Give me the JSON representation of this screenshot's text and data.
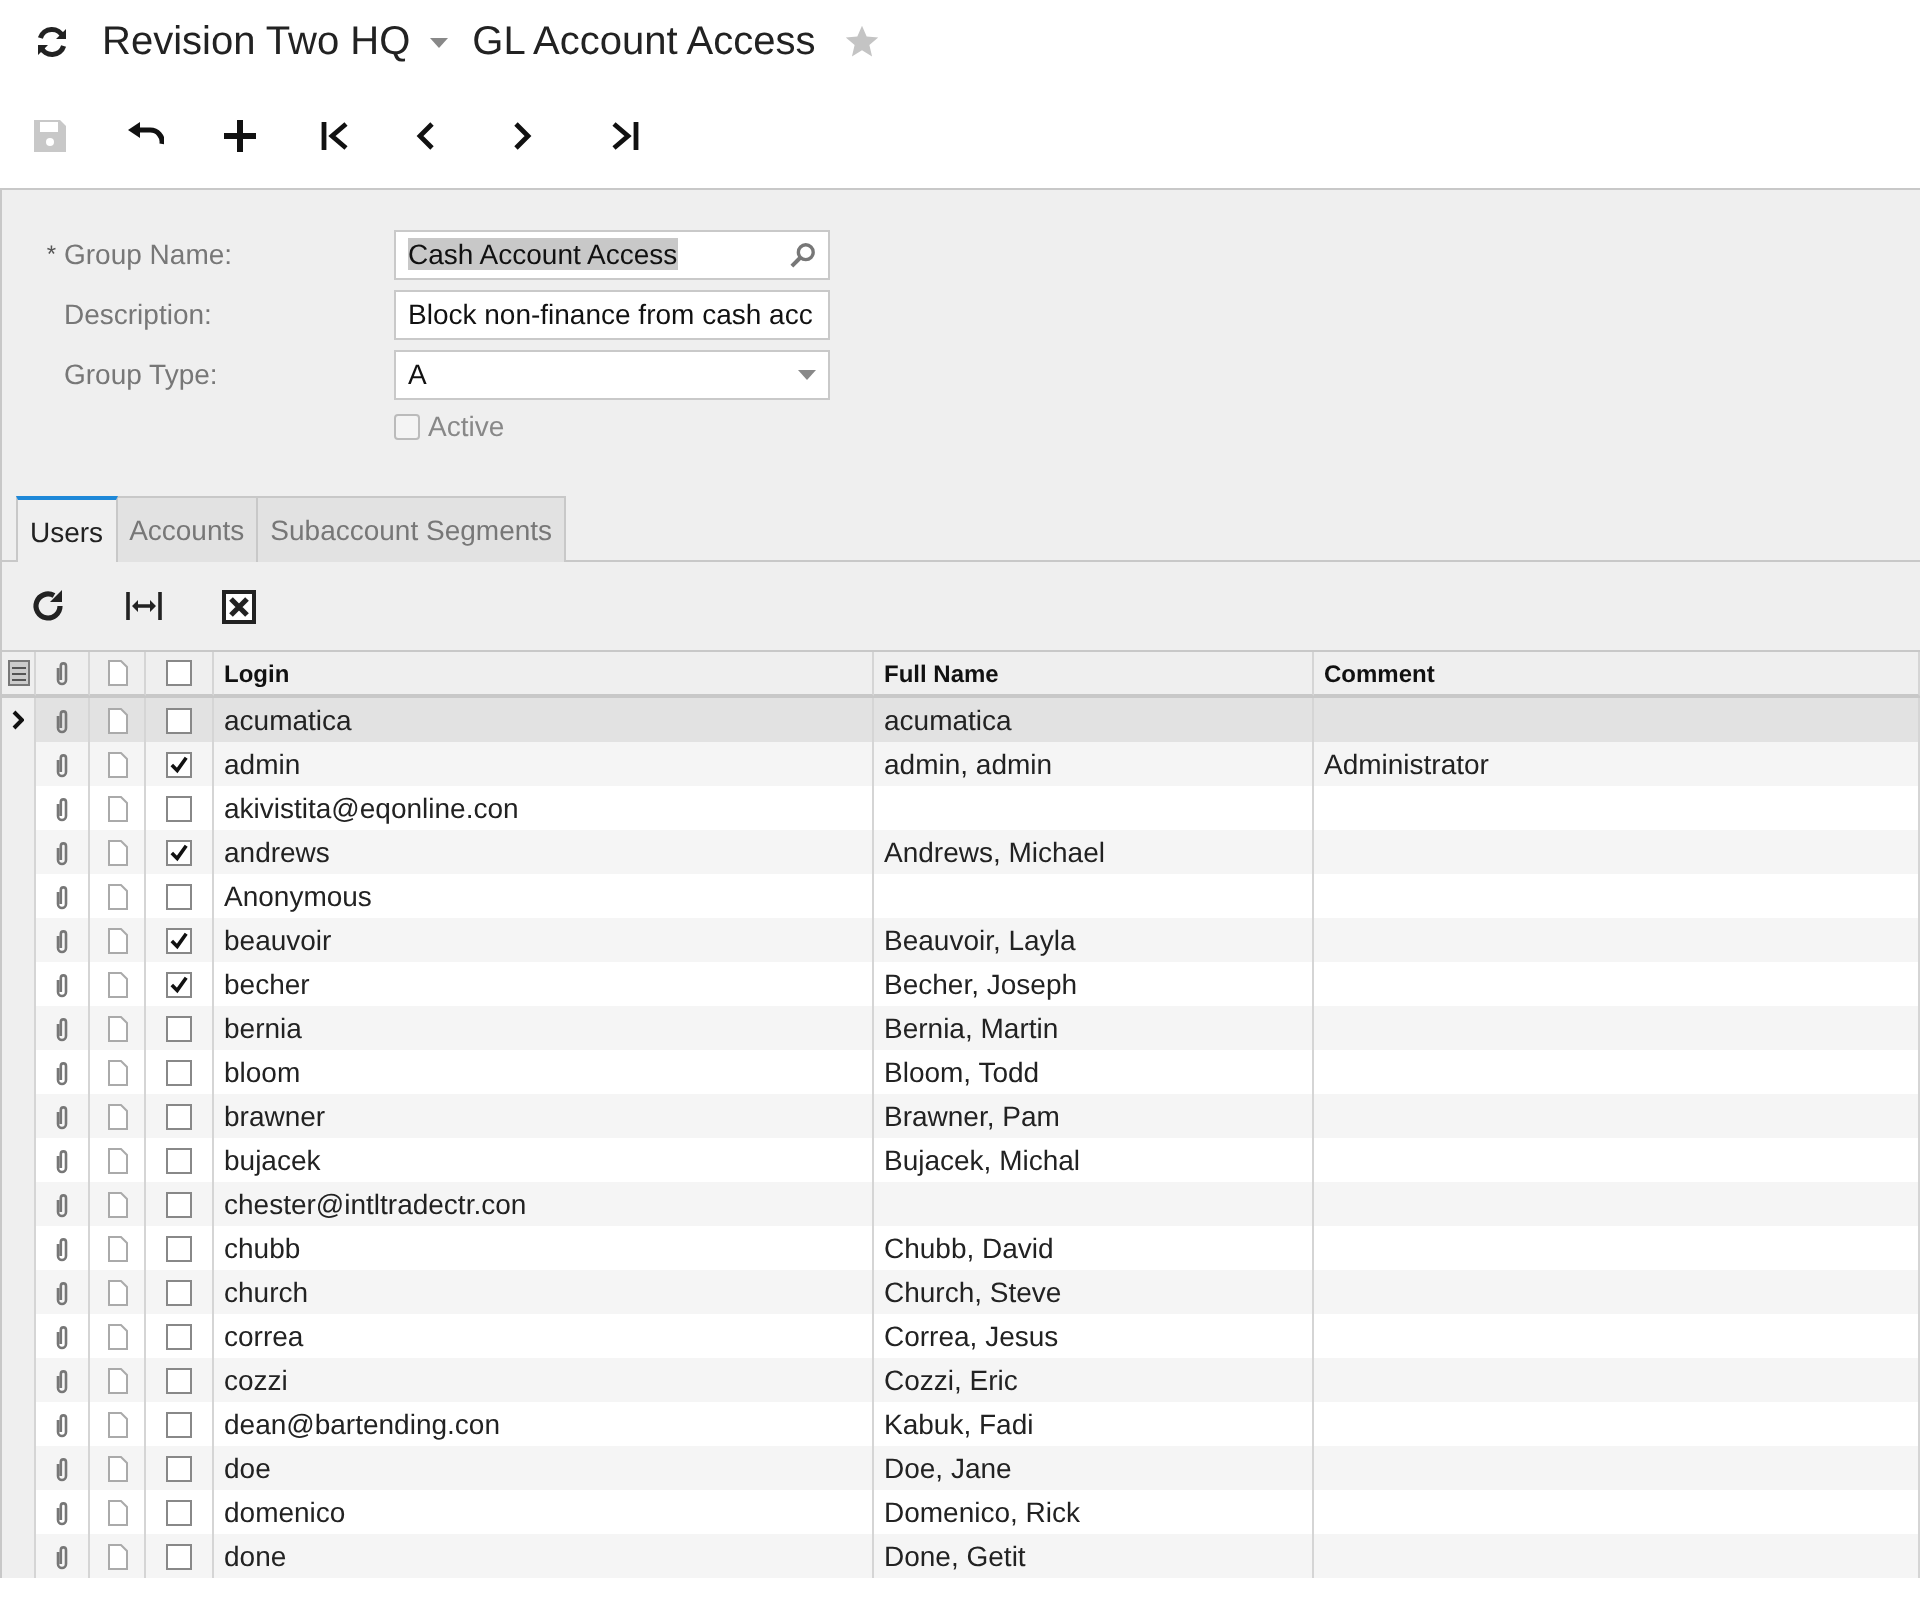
{
  "header": {
    "company": "Revision Two HQ",
    "title": "GL Account Access",
    "favorite": false
  },
  "toolbar": {
    "save_disabled": true
  },
  "form": {
    "group_name": {
      "label": "Group Name:",
      "value": "Cash Account Access",
      "required_mark": "*"
    },
    "description": {
      "label": "Description:",
      "value": "Block non-finance from cash acc"
    },
    "group_type": {
      "label": "Group Type:",
      "value": "A"
    },
    "active": {
      "label": "Active",
      "checked": false,
      "disabled": true
    }
  },
  "tabs": [
    {
      "label": "Users",
      "selected": true
    },
    {
      "label": "Accounts",
      "selected": false
    },
    {
      "label": "Subaccount Segments",
      "selected": false
    }
  ],
  "table": {
    "columns": [
      "Login",
      "Full Name",
      "Comment"
    ],
    "all_included": false,
    "rows": [
      {
        "login": "acumatica",
        "full_name": "acumatica",
        "comment": "",
        "included": false,
        "selected": true
      },
      {
        "login": "admin",
        "full_name": "admin, admin",
        "comment": "Administrator",
        "included": true,
        "selected": false
      },
      {
        "login": "akivistita@eqonline.con",
        "full_name": "",
        "comment": "",
        "included": false,
        "selected": false
      },
      {
        "login": "andrews",
        "full_name": "Andrews, Michael",
        "comment": "",
        "included": true,
        "selected": false
      },
      {
        "login": "Anonymous",
        "full_name": "",
        "comment": "",
        "included": false,
        "selected": false
      },
      {
        "login": "beauvoir",
        "full_name": "Beauvoir, Layla",
        "comment": "",
        "included": true,
        "selected": false
      },
      {
        "login": "becher",
        "full_name": "Becher, Joseph",
        "comment": "",
        "included": true,
        "selected": false
      },
      {
        "login": "bernia",
        "full_name": "Bernia, Martin",
        "comment": "",
        "included": false,
        "selected": false
      },
      {
        "login": "bloom",
        "full_name": "Bloom, Todd",
        "comment": "",
        "included": false,
        "selected": false
      },
      {
        "login": "brawner",
        "full_name": "Brawner, Pam",
        "comment": "",
        "included": false,
        "selected": false
      },
      {
        "login": "bujacek",
        "full_name": "Bujacek, Michal",
        "comment": "",
        "included": false,
        "selected": false
      },
      {
        "login": "chester@intltradectr.con",
        "full_name": "",
        "comment": "",
        "included": false,
        "selected": false
      },
      {
        "login": "chubb",
        "full_name": "Chubb, David",
        "comment": "",
        "included": false,
        "selected": false
      },
      {
        "login": "church",
        "full_name": "Church, Steve",
        "comment": "",
        "included": false,
        "selected": false
      },
      {
        "login": "correa",
        "full_name": "Correa, Jesus",
        "comment": "",
        "included": false,
        "selected": false
      },
      {
        "login": "cozzi",
        "full_name": "Cozzi, Eric",
        "comment": "",
        "included": false,
        "selected": false
      },
      {
        "login": "dean@bartending.con",
        "full_name": "Kabuk, Fadi",
        "comment": "",
        "included": false,
        "selected": false
      },
      {
        "login": "doe",
        "full_name": "Doe, Jane",
        "comment": "",
        "included": false,
        "selected": false
      },
      {
        "login": "domenico",
        "full_name": "Domenico, Rick",
        "comment": "",
        "included": false,
        "selected": false
      },
      {
        "login": "done",
        "full_name": "Done, Getit",
        "comment": "",
        "included": false,
        "selected": false
      }
    ]
  }
}
